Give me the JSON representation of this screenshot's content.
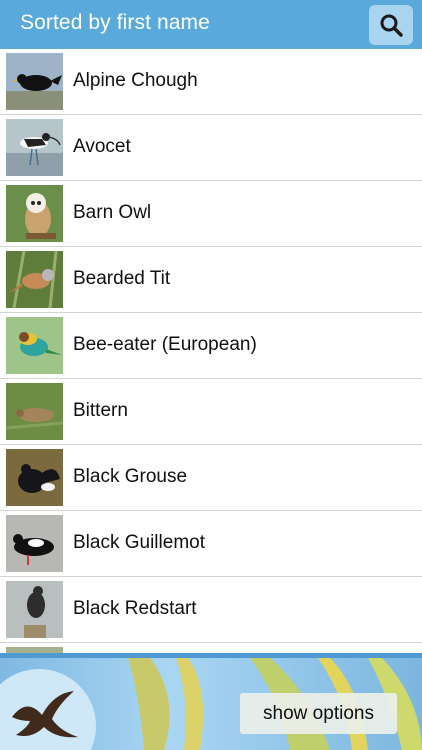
{
  "header": {
    "title": "Sorted by first name",
    "search_icon": "search-icon"
  },
  "list": {
    "items": [
      {
        "label": "Alpine Chough",
        "thumb": "bird-thumb"
      },
      {
        "label": "Avocet",
        "thumb": "bird-thumb"
      },
      {
        "label": "Barn Owl",
        "thumb": "bird-thumb"
      },
      {
        "label": "Bearded Tit",
        "thumb": "bird-thumb"
      },
      {
        "label": "Bee-eater (European)",
        "thumb": "bird-thumb"
      },
      {
        "label": "Bittern",
        "thumb": "bird-thumb"
      },
      {
        "label": "Black Grouse",
        "thumb": "bird-thumb"
      },
      {
        "label": "Black Guillemot",
        "thumb": "bird-thumb"
      },
      {
        "label": "Black Redstart",
        "thumb": "bird-thumb"
      }
    ]
  },
  "footer": {
    "show_options_label": "show options",
    "logo_icon": "swallow-logo-icon"
  },
  "colors": {
    "header_bg": "#5aa9db",
    "search_btn_bg": "#a9d4ef",
    "row_divider": "#d4d4d4"
  }
}
